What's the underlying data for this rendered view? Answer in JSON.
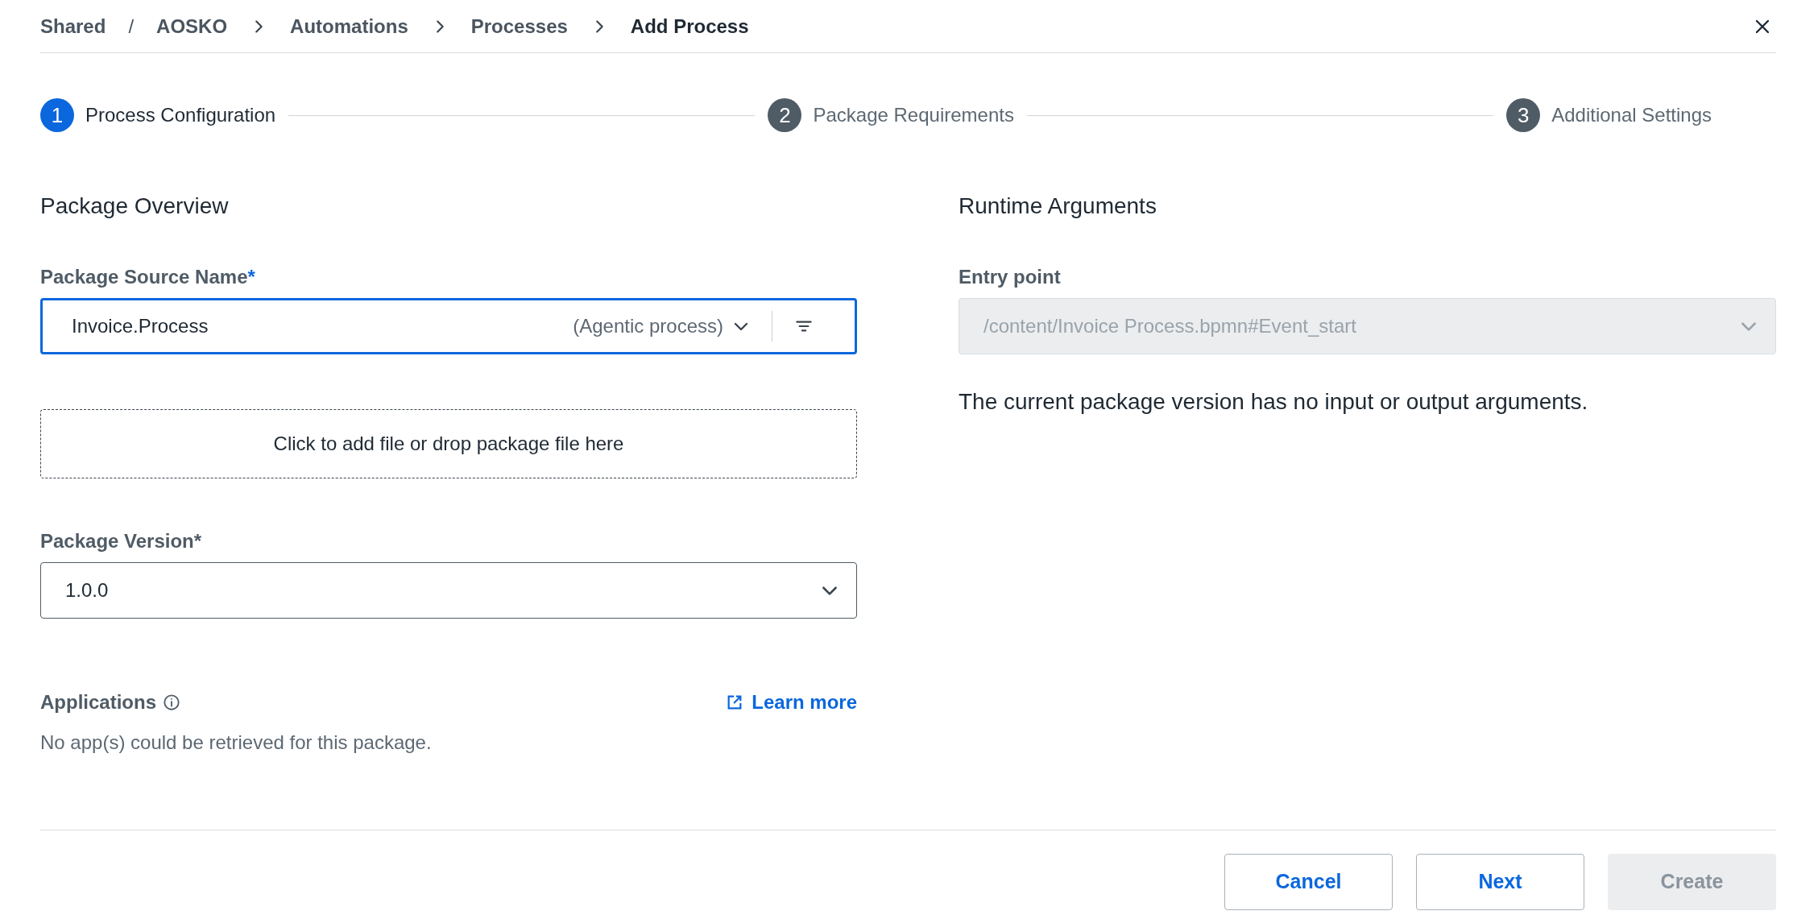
{
  "breadcrumb": [
    {
      "kind": "link",
      "text": "Shared"
    },
    {
      "kind": "slash",
      "text": "/"
    },
    {
      "kind": "link",
      "text": "AOSKO"
    },
    {
      "kind": "chevron"
    },
    {
      "kind": "link",
      "text": "Automations"
    },
    {
      "kind": "chevron"
    },
    {
      "kind": "link",
      "text": "Processes"
    },
    {
      "kind": "chevron"
    },
    {
      "kind": "current",
      "text": "Add Process"
    }
  ],
  "steps": [
    {
      "number": "1",
      "label": "Process Configuration",
      "selected": true
    },
    {
      "number": "2",
      "label": "Package Requirements",
      "selected": false
    },
    {
      "number": "3",
      "label": "Additional Settings",
      "selected": false
    }
  ],
  "package_overview": {
    "title": "Package Overview",
    "source_name": {
      "label": "Package Source Name",
      "required_mark": "*",
      "value": "Invoice.Process",
      "type_hint": "(Agentic process)",
      "focused": true
    },
    "drop_zone": "Click to add file or drop package file here",
    "version": {
      "label": "Package Version",
      "required_mark": "*",
      "value": "1.0.0"
    },
    "applications": {
      "label": "Applications",
      "link": "Learn more",
      "message": "No app(s) could be retrieved for this package."
    }
  },
  "runtime_arguments": {
    "title": "Runtime Arguments",
    "entry_point": {
      "label": "Entry point",
      "value": "/content/Invoice Process.bpmn#Event_start",
      "disabled": true
    },
    "message": "The current package version has no input or output arguments."
  },
  "buttons": [
    {
      "label": "Cancel",
      "disabled": false
    },
    {
      "label": "Next",
      "disabled": false
    },
    {
      "label": "Create",
      "disabled": true
    }
  ]
}
